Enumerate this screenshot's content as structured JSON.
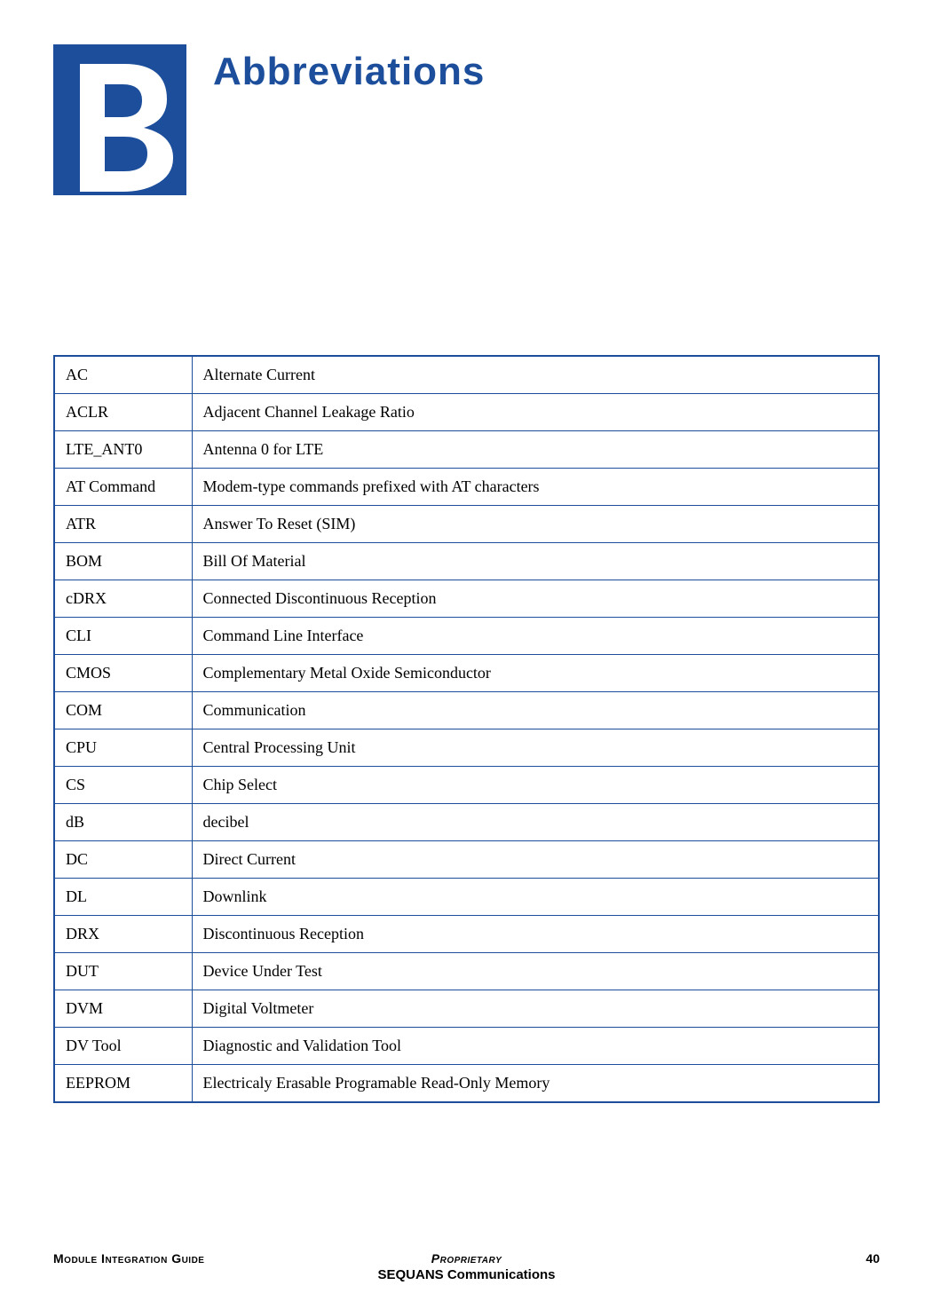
{
  "header": {
    "appendix_letter": "B",
    "title": "Abbreviations"
  },
  "table": {
    "rows": [
      {
        "term": "AC",
        "def": "Alternate Current"
      },
      {
        "term": "ACLR",
        "def": "Adjacent Channel Leakage Ratio"
      },
      {
        "term": "LTE_ANT0",
        "def": "Antenna 0 for LTE"
      },
      {
        "term": "AT Command",
        "def": "Modem-type commands prefixed with AT characters"
      },
      {
        "term": "ATR",
        "def": "Answer To Reset (SIM)"
      },
      {
        "term": "BOM",
        "def": "Bill Of Material"
      },
      {
        "term": "cDRX",
        "def": "Connected Discontinuous Reception"
      },
      {
        "term": "CLI",
        "def": "Command Line Interface"
      },
      {
        "term": "CMOS",
        "def": "Complementary Metal Oxide Semiconductor"
      },
      {
        "term": "COM",
        "def": "Communication"
      },
      {
        "term": "CPU",
        "def": "Central Processing Unit"
      },
      {
        "term": "CS",
        "def": "Chip Select"
      },
      {
        "term": "dB",
        "def": "decibel"
      },
      {
        "term": "DC",
        "def": "Direct Current"
      },
      {
        "term": "DL",
        "def": "Downlink"
      },
      {
        "term": "DRX",
        "def": "Discontinuous Reception"
      },
      {
        "term": "DUT",
        "def": "Device Under Test"
      },
      {
        "term": "DVM",
        "def": "Digital Voltmeter"
      },
      {
        "term": "DV Tool",
        "def": "Diagnostic and Validation Tool"
      },
      {
        "term": "EEPROM",
        "def": "Electricaly Erasable Programable Read-Only Memory"
      }
    ]
  },
  "footer": {
    "left": "Module Integration Guide",
    "center": "Proprietary",
    "right": "40",
    "line2": "SEQUANS Communications"
  }
}
